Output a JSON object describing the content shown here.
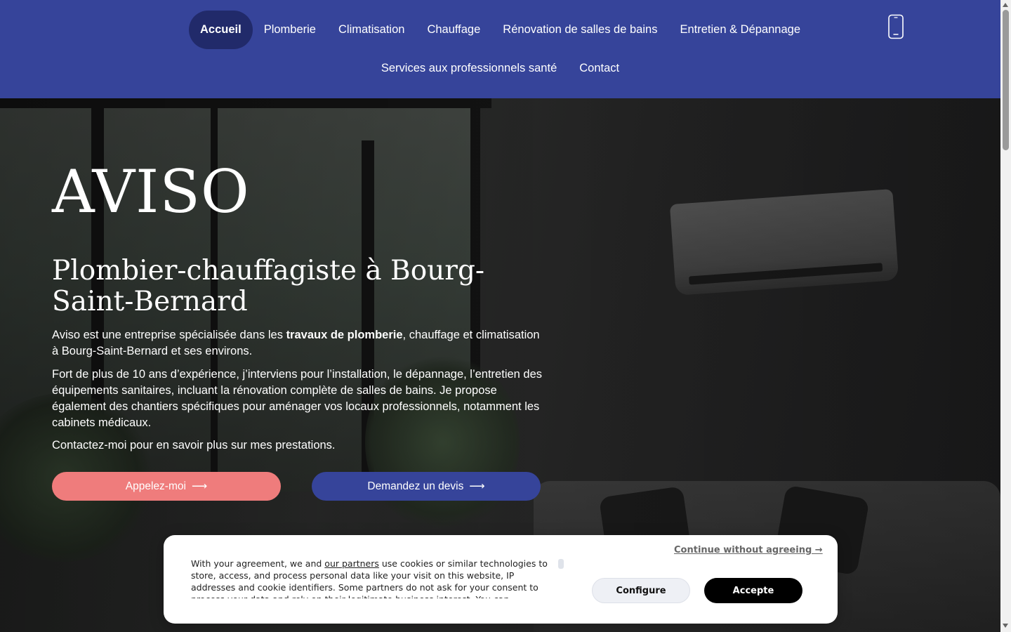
{
  "nav": {
    "row1": [
      "Accueil",
      "Plomberie",
      "Climatisation",
      "Chauffage",
      "Rénovation de salles de bains",
      "Entretien & Dépannage"
    ],
    "row2": [
      "Services aux professionnels santé",
      "Contact"
    ],
    "active": "Accueil",
    "phone_icon": "smartphone-icon"
  },
  "hero": {
    "title": "AVISO",
    "subtitle": "Plombier-chauffagiste à Bourg-Saint-Bernard",
    "p1_before": "Aviso est une entreprise spécialisée dans les ",
    "p1_bold": "travaux de plomberie",
    "p1_after": ", chauffage et climatisation à Bourg-Saint-Bernard et ses environs.",
    "p2": "Fort de plus de 10 ans d’expérience, j’interviens pour l’installation, le dépannage, l’entretien des équipements sanitaires, incluant la rénovation complète de salles de bains. Je propose également des chantiers spécifiques pour aménager vos locaux professionnels, notamment les cabinets médicaux.",
    "p3": "Contactez-moi pour en savoir plus sur mes prestations.",
    "btn_call": "Appelez-moi",
    "btn_quote": "Demandez un devis",
    "arrow": "⟶"
  },
  "cookie": {
    "text_before": "With your agreement, we and ",
    "partners_link": "our partners",
    "text_after": " use cookies or similar technologies to store, access, and process personal data like your visit on this website, IP addresses and cookie identifiers. Some partners do not ask for your consent to process your data and rely on their legitimate business interest. You can",
    "continue": "Continue without agreeing →",
    "configure": "Configure",
    "accept": "Accepte"
  },
  "colors": {
    "header": "#36449a",
    "active_nav": "#212a6a",
    "call_button": "#ef7c7c",
    "quote_button": "#36449a"
  }
}
